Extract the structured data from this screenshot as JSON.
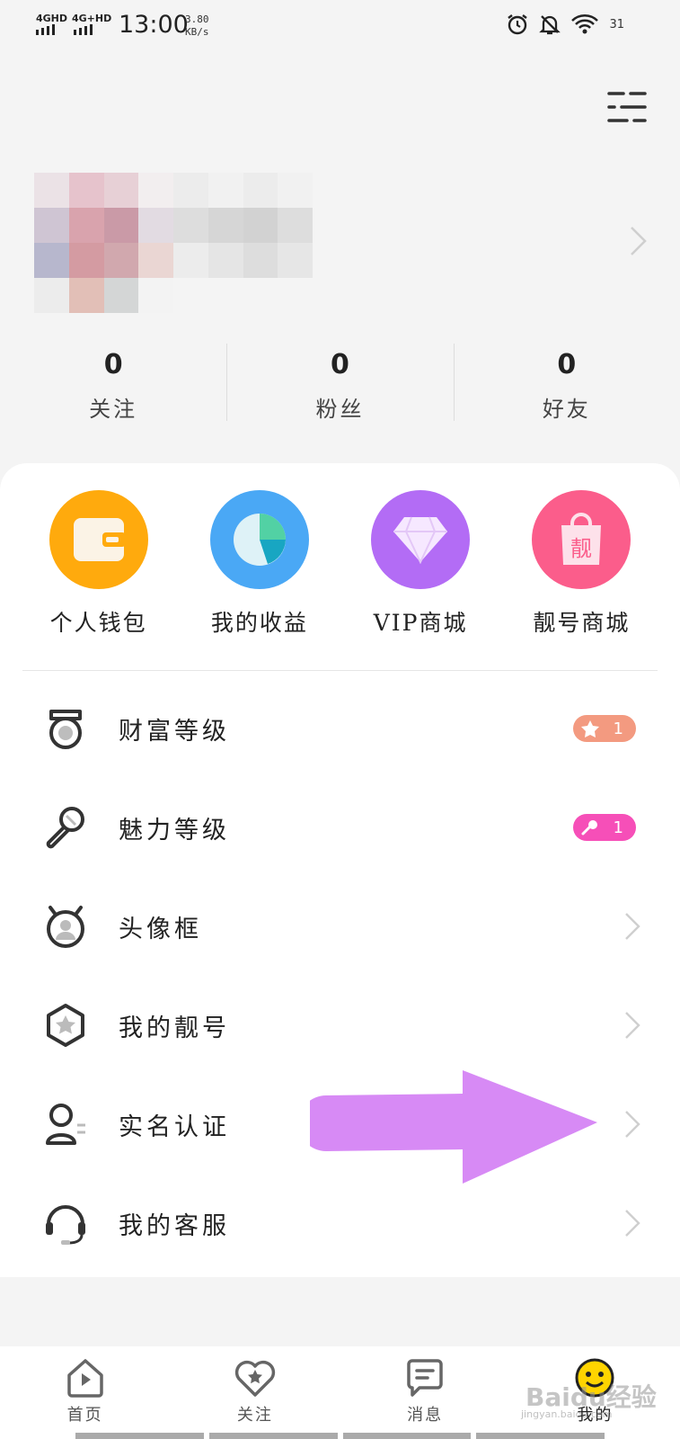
{
  "status_bar": {
    "network1": "4GHD",
    "network2": "4G+HD",
    "time": "13:00",
    "speed_value": "3.80",
    "speed_unit": "KB/s",
    "battery": "31",
    "icons": [
      "alarm-icon",
      "bell-off-icon",
      "wifi-icon"
    ]
  },
  "profile": {
    "stats": [
      {
        "value": "0",
        "label": "关注"
      },
      {
        "value": "0",
        "label": "粉丝"
      },
      {
        "value": "0",
        "label": "好友"
      }
    ]
  },
  "shortcuts": [
    {
      "label": "个人钱包",
      "icon": "wallet-icon",
      "color": "#FFAA0D"
    },
    {
      "label": "我的收益",
      "icon": "pie-chart-icon",
      "color": "#4AA8F5"
    },
    {
      "label": "VIP商城",
      "icon": "diamond-icon",
      "color": "#B36CF5"
    },
    {
      "label": "靓号商城",
      "icon": "shopping-bag-icon",
      "color": "#FB5D8B",
      "bag_text": "靓"
    }
  ],
  "menu": [
    {
      "label": "财富等级",
      "icon": "medal-icon",
      "badge": "1",
      "badge_icon": "star-icon"
    },
    {
      "label": "魅力等级",
      "icon": "microphone-icon",
      "badge": "1",
      "badge_icon": "microphone-icon"
    },
    {
      "label": "头像框",
      "icon": "avatar-frame-icon"
    },
    {
      "label": "我的靓号",
      "icon": "hexagon-star-icon"
    },
    {
      "label": "实名认证",
      "icon": "id-verify-icon"
    },
    {
      "label": "我的客服",
      "icon": "headset-icon"
    }
  ],
  "tabs": [
    {
      "label": "首页",
      "icon": "home-icon"
    },
    {
      "label": "关注",
      "icon": "heart-star-icon"
    },
    {
      "label": "消息",
      "icon": "message-icon"
    },
    {
      "label": "我的",
      "icon": "emoji-face-icon",
      "active": true
    }
  ],
  "watermark": {
    "text": "Baidu经验",
    "sub": "jingyan.baidu.com"
  },
  "colors": {
    "annotation_arrow": "#D78AF5",
    "wealth_badge": "#F39A80",
    "charm_badge": "#F64FB8"
  }
}
